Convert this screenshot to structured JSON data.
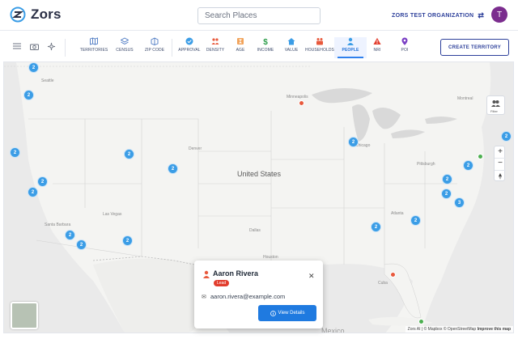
{
  "header": {
    "logo_text": "Zors",
    "search_placeholder": "Search Places",
    "org_name": "ZORS TEST ORGANIZATION",
    "avatar_letter": "T"
  },
  "toolbar": {
    "tabs": [
      {
        "label": "TERRITORIES",
        "icon": "map-icon",
        "color": "#4a78c2"
      },
      {
        "label": "CENSUS",
        "icon": "layers-icon",
        "color": "#4a78c2"
      },
      {
        "label": "ZIP CODE",
        "icon": "zip-icon",
        "color": "#4a78c2"
      },
      {
        "label": "APPROVAL",
        "icon": "check-circle-icon",
        "color": "#3b9de6"
      },
      {
        "label": "DENSITY",
        "icon": "people-group-icon",
        "color": "#e8593c"
      },
      {
        "label": "AGE",
        "icon": "hourglass-icon",
        "color": "#f2a35a"
      },
      {
        "label": "INCOME",
        "icon": "dollar-icon",
        "color": "#2e9e4b"
      },
      {
        "label": "VALUE",
        "icon": "house-icon",
        "color": "#3b9de6"
      },
      {
        "label": "HOUSEHOLDS",
        "icon": "family-icon",
        "color": "#e8593c"
      },
      {
        "label": "PEOPLE",
        "icon": "person-icon",
        "color": "#3b9de6"
      },
      {
        "label": "NRI",
        "icon": "warning-icon",
        "color": "#e23d2d"
      },
      {
        "label": "POI",
        "icon": "pin-icon",
        "color": "#7a3fc4"
      }
    ],
    "active_tab": "PEOPLE",
    "create_button": "CREATE TERRITORY"
  },
  "map": {
    "country_label": "United States",
    "labels": [
      "Minneapolis",
      "Chicago",
      "Denver",
      "Las Vegas",
      "Santa Barbara",
      "Dallas",
      "Houston",
      "Atlanta",
      "Montreal",
      "Pittsburgh",
      "Seattle",
      "Mexico",
      "Cuba"
    ],
    "filter_label": "Filter",
    "attribution_left": "Zors AI",
    "attribution_mid": "© Mapbox © OpenStreetMap",
    "attribution_right": "Improve this map",
    "clusters": [
      "2",
      "2",
      "2",
      "2",
      "2",
      "2",
      "2",
      "2",
      "2",
      "2",
      "2",
      "2",
      "2",
      "2",
      "2",
      "2",
      "2",
      "3",
      "2"
    ]
  },
  "popup": {
    "name": "Aaron Rivera",
    "badge": "Lead",
    "email": "aaron.rivera@example.com",
    "button": "View Details"
  }
}
